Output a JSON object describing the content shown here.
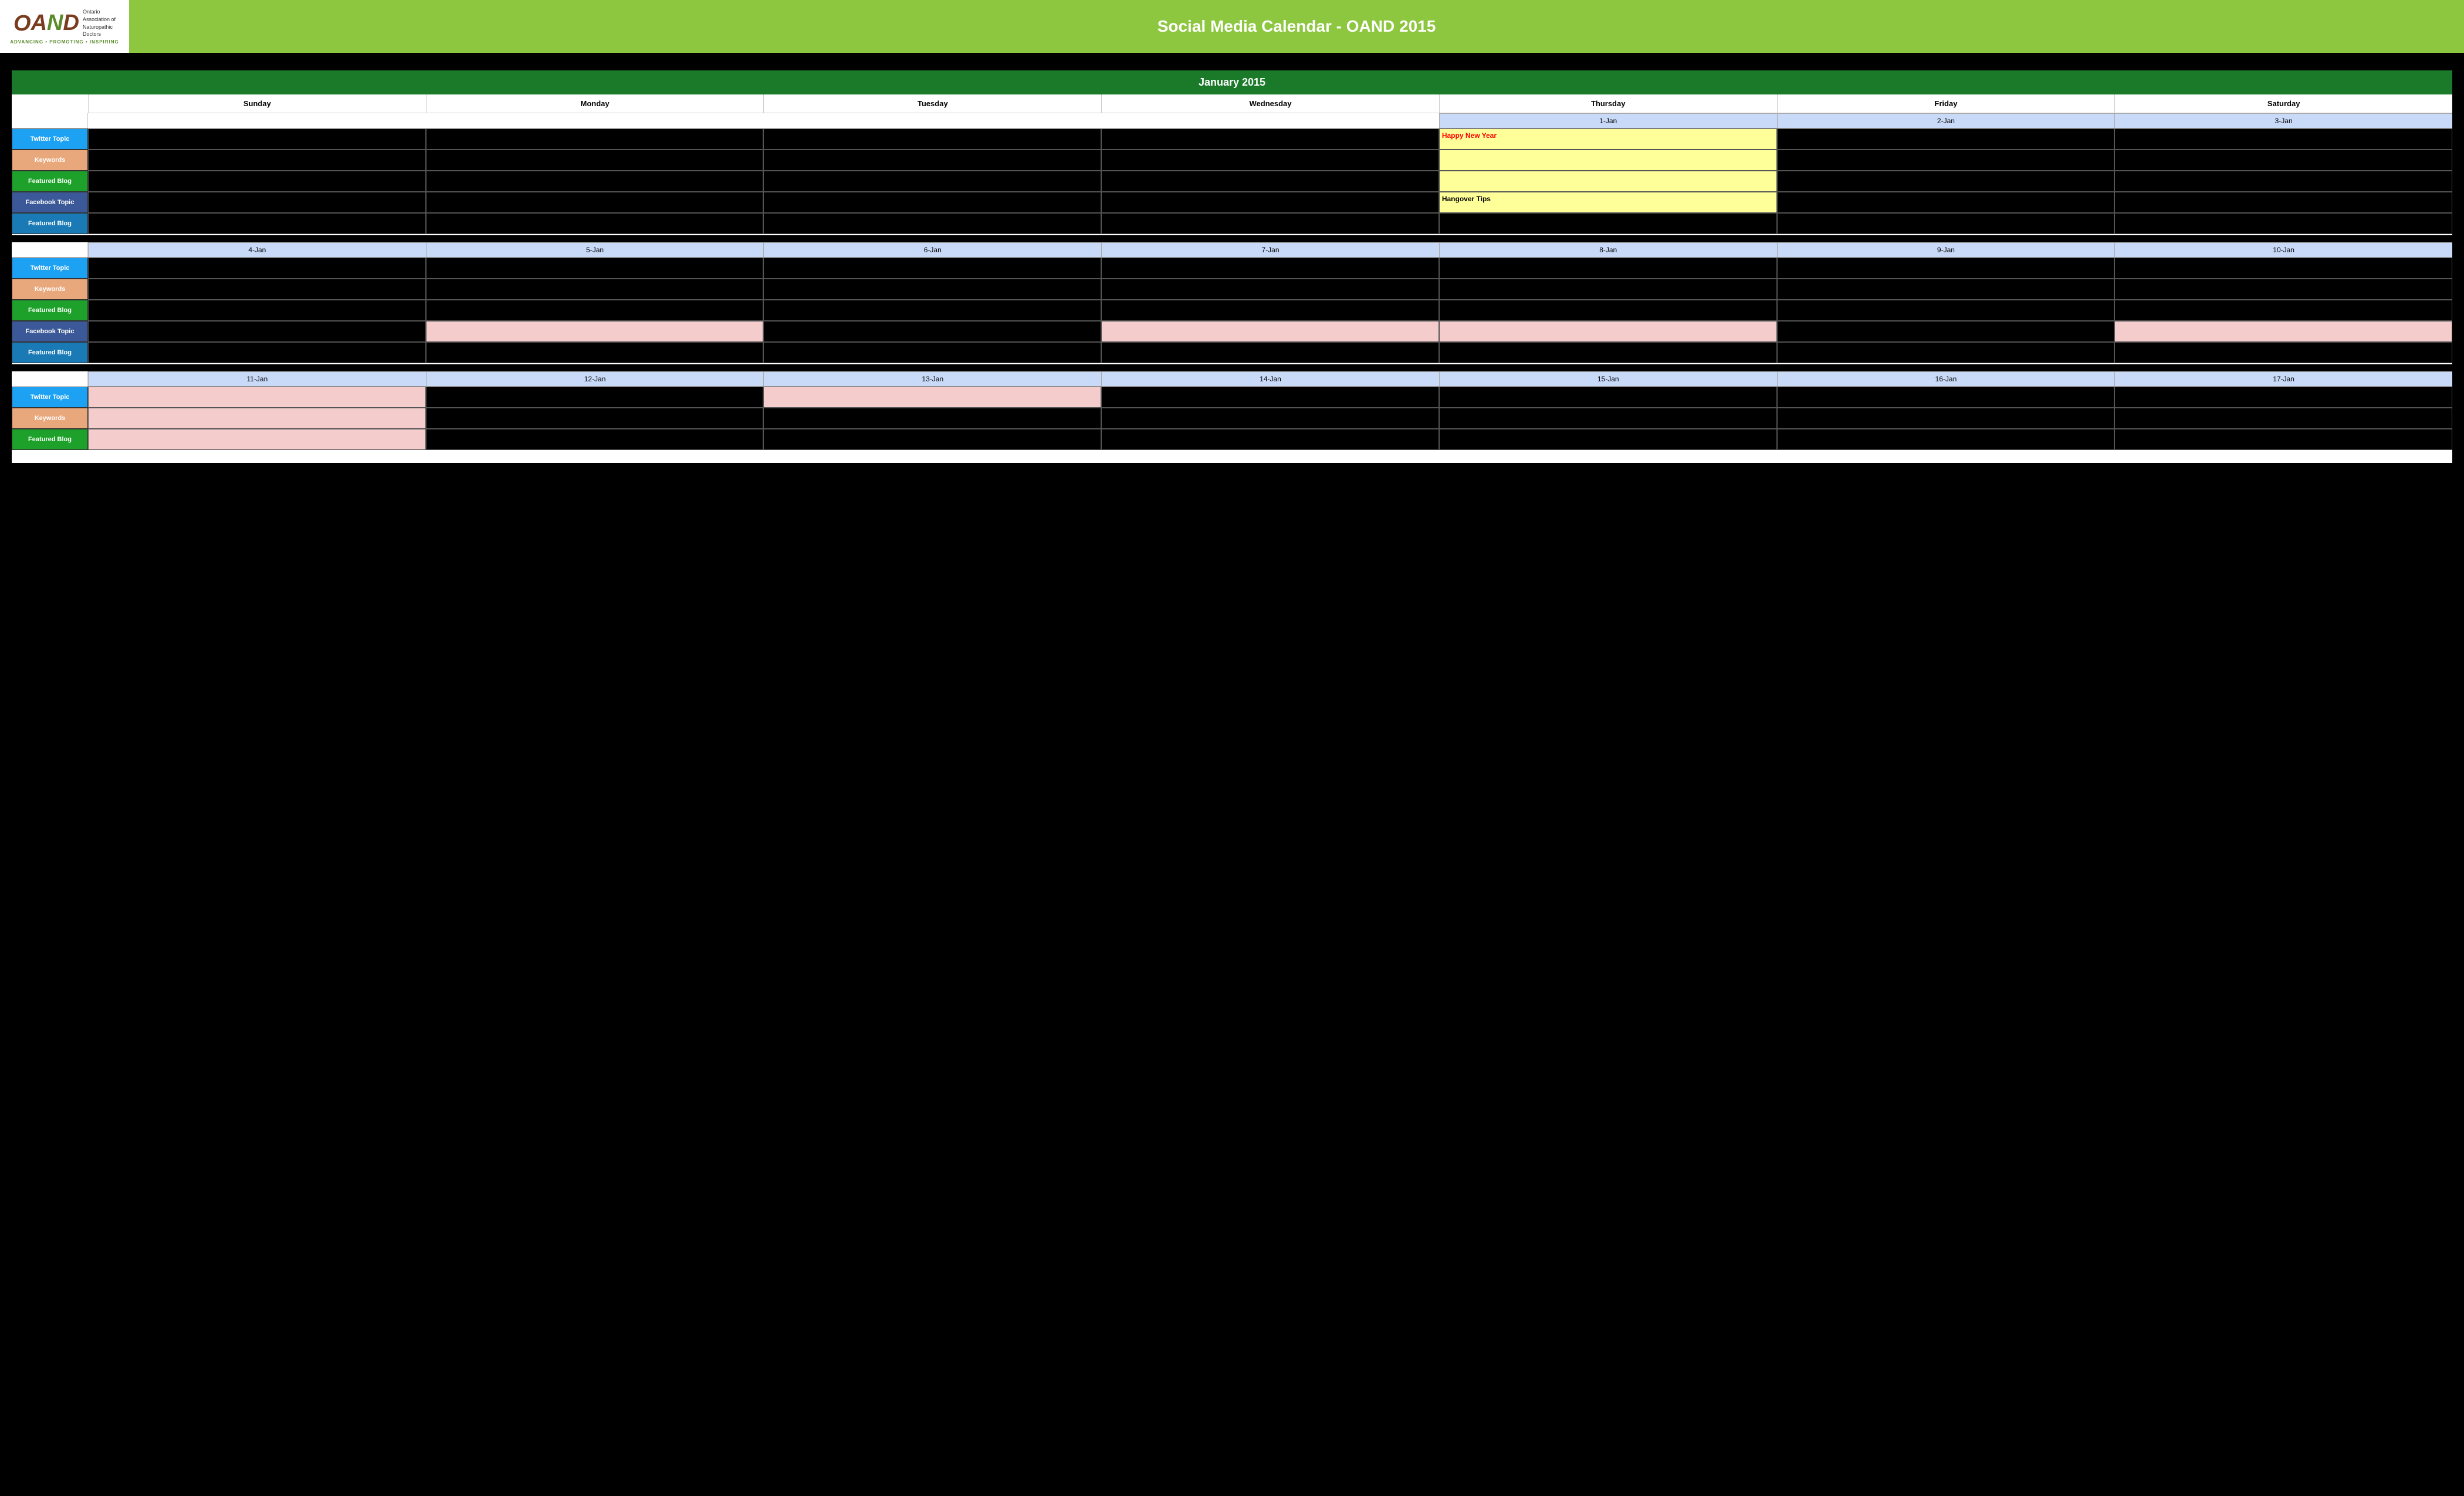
{
  "header": {
    "logo": {
      "letters": "OAND",
      "org_name": "Ontario\nAssociation of\nNaturopathic\nDoctors",
      "tagline": "ADVANCING • PROMOTING • INSPIRING"
    },
    "title": "Social Media Calendar - OAND 2015"
  },
  "calendar": {
    "month": "January 2015",
    "day_headers": [
      "Sunday",
      "Monday",
      "Tuesday",
      "Wednesday",
      "Thursday",
      "Friday",
      "Saturday"
    ],
    "weeks": [
      {
        "dates": [
          "",
          "",
          "",
          "",
          "1-Jan",
          "2-Jan",
          "3-Jan"
        ],
        "rows": [
          {
            "label": "Twitter Topic",
            "type": "twitter",
            "cells": [
              "black",
              "black",
              "black",
              "black",
              "yellow",
              "black",
              "black"
            ],
            "cell_texts": [
              "",
              "",
              "",
              "",
              "Happy New Year",
              "",
              ""
            ]
          },
          {
            "label": "Keywords",
            "type": "keywords",
            "cells": [
              "black",
              "black",
              "black",
              "black",
              "yellow",
              "black",
              "black"
            ],
            "cell_texts": [
              "",
              "",
              "",
              "",
              "",
              "",
              ""
            ]
          },
          {
            "label": "Featured Blog",
            "type": "featured",
            "cells": [
              "black",
              "black",
              "black",
              "black",
              "yellow",
              "black",
              "black"
            ],
            "cell_texts": [
              "",
              "",
              "",
              "",
              "",
              "",
              ""
            ]
          },
          {
            "label": "Facebook Topic",
            "type": "facebook",
            "cells": [
              "black",
              "black",
              "black",
              "black",
              "yellow",
              "black",
              "black"
            ],
            "cell_texts": [
              "",
              "",
              "",
              "",
              "Hangover Tips",
              "",
              ""
            ]
          },
          {
            "label": "Featured Blog",
            "type": "featured-blue",
            "cells": [
              "black",
              "black",
              "black",
              "black",
              "black",
              "black",
              "black"
            ],
            "cell_texts": [
              "",
              "",
              "",
              "",
              "",
              "",
              ""
            ]
          }
        ]
      },
      {
        "dates": [
          "4-Jan",
          "5-Jan",
          "6-Jan",
          "7-Jan",
          "8-Jan",
          "9-Jan",
          "10-Jan"
        ],
        "rows": [
          {
            "label": "Twitter Topic",
            "type": "twitter",
            "cells": [
              "black",
              "black",
              "black",
              "black",
              "black",
              "black",
              "black"
            ],
            "cell_texts": [
              "",
              "",
              "",
              "",
              "",
              "",
              ""
            ]
          },
          {
            "label": "Keywords",
            "type": "keywords",
            "cells": [
              "black",
              "black",
              "black",
              "black",
              "black",
              "black",
              "black"
            ],
            "cell_texts": [
              "",
              "",
              "",
              "",
              "",
              "",
              ""
            ]
          },
          {
            "label": "Featured Blog",
            "type": "featured",
            "cells": [
              "black",
              "black",
              "black",
              "black",
              "black",
              "black",
              "black"
            ],
            "cell_texts": [
              "",
              "",
              "",
              "",
              "",
              "",
              ""
            ]
          },
          {
            "label": "Facebook Topic",
            "type": "facebook",
            "cells": [
              "black",
              "light-pink",
              "black",
              "light-pink",
              "light-pink",
              "black",
              "light-pink"
            ],
            "cell_texts": [
              "",
              "",
              "",
              "",
              "",
              "",
              ""
            ]
          },
          {
            "label": "Featured Blog",
            "type": "featured-blue",
            "cells": [
              "black",
              "black",
              "black",
              "black",
              "black",
              "black",
              "black"
            ],
            "cell_texts": [
              "",
              "",
              "",
              "",
              "",
              "",
              ""
            ]
          }
        ]
      },
      {
        "dates": [
          "11-Jan",
          "12-Jan",
          "13-Jan",
          "14-Jan",
          "15-Jan",
          "16-Jan",
          "17-Jan"
        ],
        "rows": [
          {
            "label": "Twitter Topic",
            "type": "twitter",
            "cells": [
              "light-pink",
              "black",
              "light-pink",
              "black",
              "black",
              "black",
              "black"
            ],
            "cell_texts": [
              "",
              "",
              "",
              "",
              "",
              "",
              ""
            ]
          },
          {
            "label": "Keywords",
            "type": "keywords",
            "cells": [
              "light-pink",
              "black",
              "black",
              "black",
              "black",
              "black",
              "black"
            ],
            "cell_texts": [
              "",
              "",
              "",
              "",
              "",
              "",
              ""
            ]
          },
          {
            "label": "Featured Blog",
            "type": "featured",
            "cells": [
              "light-pink",
              "black",
              "black",
              "black",
              "black",
              "black",
              "black"
            ],
            "cell_texts": [
              "",
              "",
              "",
              "",
              "",
              "",
              ""
            ]
          }
        ]
      }
    ]
  }
}
